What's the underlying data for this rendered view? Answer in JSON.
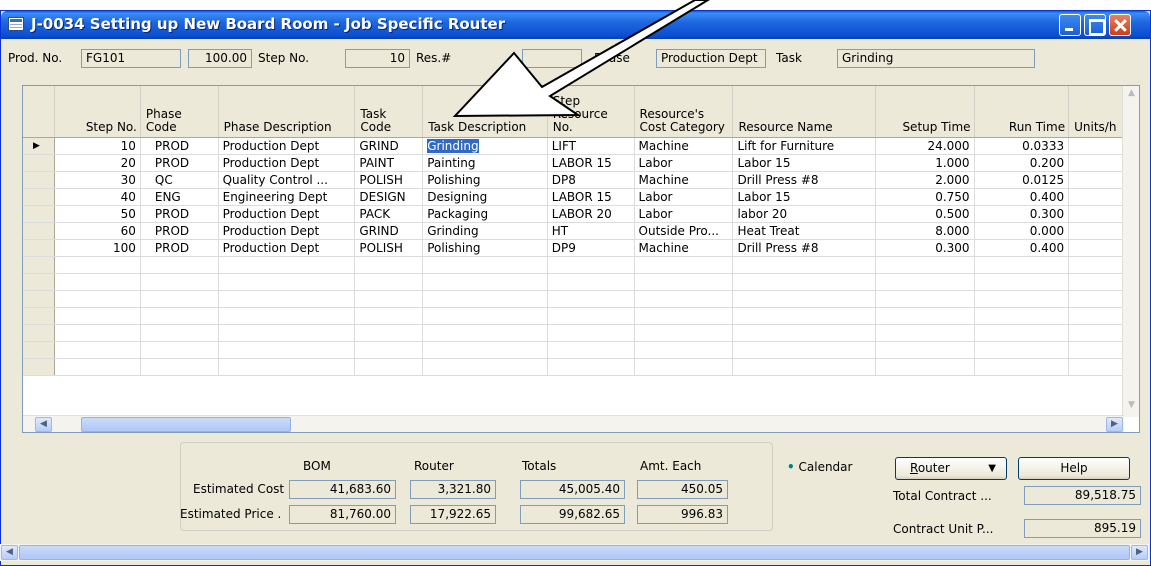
{
  "window": {
    "title": "J-0034 Setting up New Board Room - Job Specific Router"
  },
  "header": {
    "prod_no_label": "Prod. No.",
    "prod_no": "FG101",
    "qty": "100.00",
    "step_no_label": "Step No.",
    "step_no": "10",
    "res_label": "Res.#",
    "phase_label": "Phase",
    "phase": "Production Dept",
    "task_label": "Task",
    "task": "Grinding"
  },
  "grid": {
    "columns": [
      "Step No.",
      "Phase Code",
      "Phase Description",
      "Task Code",
      "Task Description",
      "Step Resource No.",
      "Resource's Cost Category",
      "Resource Name",
      "Setup Time",
      "Run Time",
      "Units/h"
    ],
    "rows": [
      [
        "10",
        "PROD",
        "Production Dept",
        "GRIND",
        "Grinding",
        "LIFT",
        "Machine",
        "Lift for Furniture",
        "24.000",
        "0.0333"
      ],
      [
        "20",
        "PROD",
        "Production Dept",
        "PAINT",
        "Painting",
        "LABOR 15",
        "Labor",
        "Labor 15",
        "1.000",
        "0.200"
      ],
      [
        "30",
        "QC",
        "Quality Control ...",
        "POLISH",
        "Polishing",
        "DP8",
        "Machine",
        "Drill Press #8",
        "2.000",
        "0.0125"
      ],
      [
        "40",
        "ENG",
        "Engineering Dept",
        "DESIGN",
        "Designing",
        "LABOR 15",
        "Labor",
        "Labor 15",
        "0.750",
        "0.400"
      ],
      [
        "50",
        "PROD",
        "Production Dept",
        "PACK",
        "Packaging",
        "LABOR 20",
        "Labor",
        "labor 20",
        "0.500",
        "0.300"
      ],
      [
        "60",
        "PROD",
        "Production Dept",
        "GRIND",
        "Grinding",
        "HT",
        "Outside Pro...",
        "Heat Treat",
        "8.000",
        "0.000"
      ],
      [
        "100",
        "PROD",
        "Production Dept",
        "POLISH",
        "Polishing",
        "DP9",
        "Machine",
        "Drill Press #8",
        "0.300",
        "0.400"
      ]
    ],
    "empty_rows": 7,
    "current_row_marker": "▶"
  },
  "summary": {
    "headers": [
      "BOM",
      "Router",
      "Totals",
      "Amt. Each"
    ],
    "estimated_cost_label": "Estimated Cost",
    "estimated_price_label": "Estimated Price",
    "dot": ".",
    "cost": [
      "41,683.60",
      "3,321.80",
      "45,005.40",
      "450.05"
    ],
    "price": [
      "81,760.00",
      "17,922.65",
      "99,682.65",
      "996.83"
    ]
  },
  "side": {
    "calendar_bullet": "•",
    "calendar": "Calendar",
    "router_button": "Router",
    "router_underline": "R",
    "router_rest": "outer",
    "help_button": "Help",
    "total_contract_label": "Total Contract ...",
    "total_contract": "89,518.75",
    "contract_unit_label": "Contract Unit P...",
    "contract_unit": "895.19"
  },
  "colors": {
    "titlebar": "#0a4fd0",
    "selection": "#316ac5",
    "window_bg": "#ece9d8",
    "calendar_dot": "#008080"
  }
}
